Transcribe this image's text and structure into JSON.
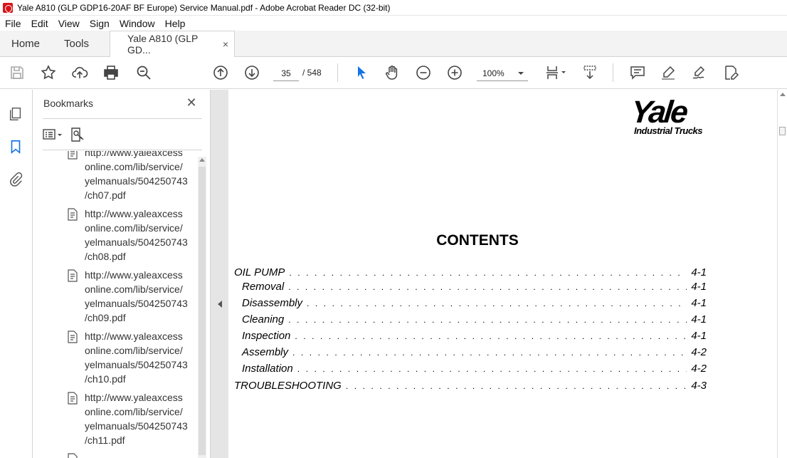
{
  "window": {
    "title": "Yale A810 (GLP GDP16-20AF BF Europe) Service Manual.pdf - Adobe Acrobat Reader DC (32-bit)"
  },
  "menu": {
    "items": [
      "File",
      "Edit",
      "View",
      "Sign",
      "Window",
      "Help"
    ]
  },
  "tabs": {
    "home": "Home",
    "tools": "Tools",
    "document": "Yale A810 (GLP GD...",
    "close": "×"
  },
  "toolbar": {
    "page_current": "35",
    "page_total": "/ 548",
    "zoom": "100%",
    "icons": [
      "save-icon",
      "star-icon",
      "upload-icon",
      "print-icon",
      "zoom-search-icon",
      "page-up-icon",
      "page-down-icon",
      "select-cursor-icon",
      "hand-icon",
      "zoom-out-icon",
      "zoom-in-icon",
      "page-layout-icon",
      "scroll-mode-icon",
      "comment-icon",
      "highlight-icon",
      "sign-icon",
      "edit-icon"
    ]
  },
  "colors": {
    "select_cursor": "#1473e6",
    "bookmark_icon": "#1473e6",
    "app_red": "#d7141a"
  },
  "bookmarks": {
    "title": "Bookmarks",
    "close": "✕",
    "items": [
      "http://www.yaleaxcess\nonline.com/lib/service/\nyelmanuals/504250743\n/ch07.pdf",
      "http://www.yaleaxcess\nonline.com/lib/service/\nyelmanuals/504250743\n/ch08.pdf",
      "http://www.yaleaxcess\nonline.com/lib/service/\nyelmanuals/504250743\n/ch09.pdf",
      "http://www.yaleaxcess\nonline.com/lib/service/\nyelmanuals/504250743\n/ch10.pdf",
      "http://www.yaleaxcess\nonline.com/lib/service/\nyelmanuals/504250743\n/ch11.pdf"
    ]
  },
  "document": {
    "logo_main": "Yale",
    "logo_sub": "Industrial Trucks",
    "heading": "CONTENTS",
    "toc": [
      {
        "label": "OIL PUMP",
        "page": "4-1",
        "level": 0
      },
      {
        "label": "Removal",
        "page": "4-1",
        "level": 1
      },
      {
        "label": "Disassembly",
        "page": "4-1",
        "level": 1
      },
      {
        "label": "Cleaning",
        "page": "4-1",
        "level": 1
      },
      {
        "label": "Inspection",
        "page": "4-1",
        "level": 1
      },
      {
        "label": "Assembly",
        "page": "4-2",
        "level": 1
      },
      {
        "label": "Installation",
        "page": "4-2",
        "level": 1
      },
      {
        "label": "TROUBLESHOOTING",
        "page": "4-3",
        "level": 0
      }
    ]
  }
}
